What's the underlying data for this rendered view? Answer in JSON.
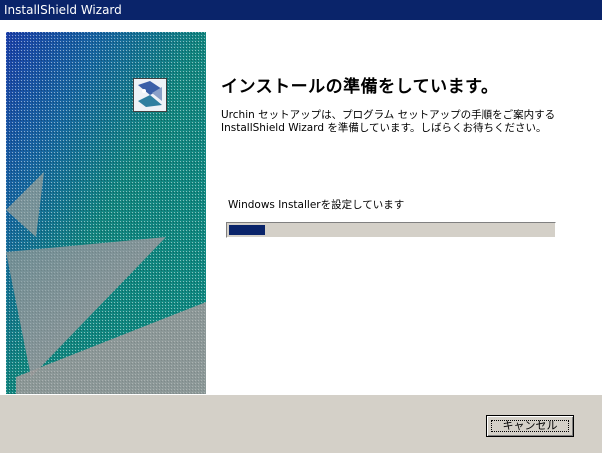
{
  "window": {
    "title": "InstallShield Wizard"
  },
  "main": {
    "heading": "インストールの準備をしています。",
    "description": "Urchin セットアップは、プログラム セットアップの手順をご案内する InstallShield Wizard を準備しています。しばらくお待ちください。",
    "status_text": "Windows Installerを設定しています",
    "progress_fraction": 0.11
  },
  "footer": {
    "cancel_label": "キャンセル"
  },
  "icons": {
    "wizard": "installshield-wizard-icon"
  },
  "colors": {
    "titlebar": "#0a246a",
    "panel_teal": "#10837f",
    "progress_fill": "#0a246a",
    "dialog_face": "#d4d0c8"
  }
}
